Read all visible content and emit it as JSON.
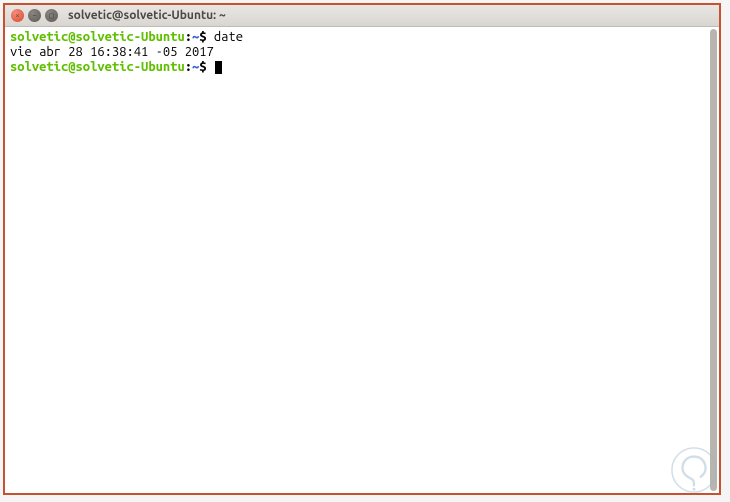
{
  "window": {
    "title": "solvetic@solvetic-Ubuntu: ~"
  },
  "terminal": {
    "lines": [
      {
        "type": "prompt",
        "user_host": "solvetic@solvetic-Ubuntu",
        "sep": ":",
        "path": "~",
        "dollar": "$",
        "command": "date"
      },
      {
        "type": "output",
        "text": "vie abr 28 16:38:41 -05 2017"
      },
      {
        "type": "prompt",
        "user_host": "solvetic@solvetic-Ubuntu",
        "sep": ":",
        "path": "~",
        "dollar": "$",
        "command": "",
        "cursor": true
      }
    ]
  },
  "colors": {
    "window_border": "#c8512f",
    "prompt_user": "#5fbf00",
    "prompt_path": "#3a5fcd"
  }
}
